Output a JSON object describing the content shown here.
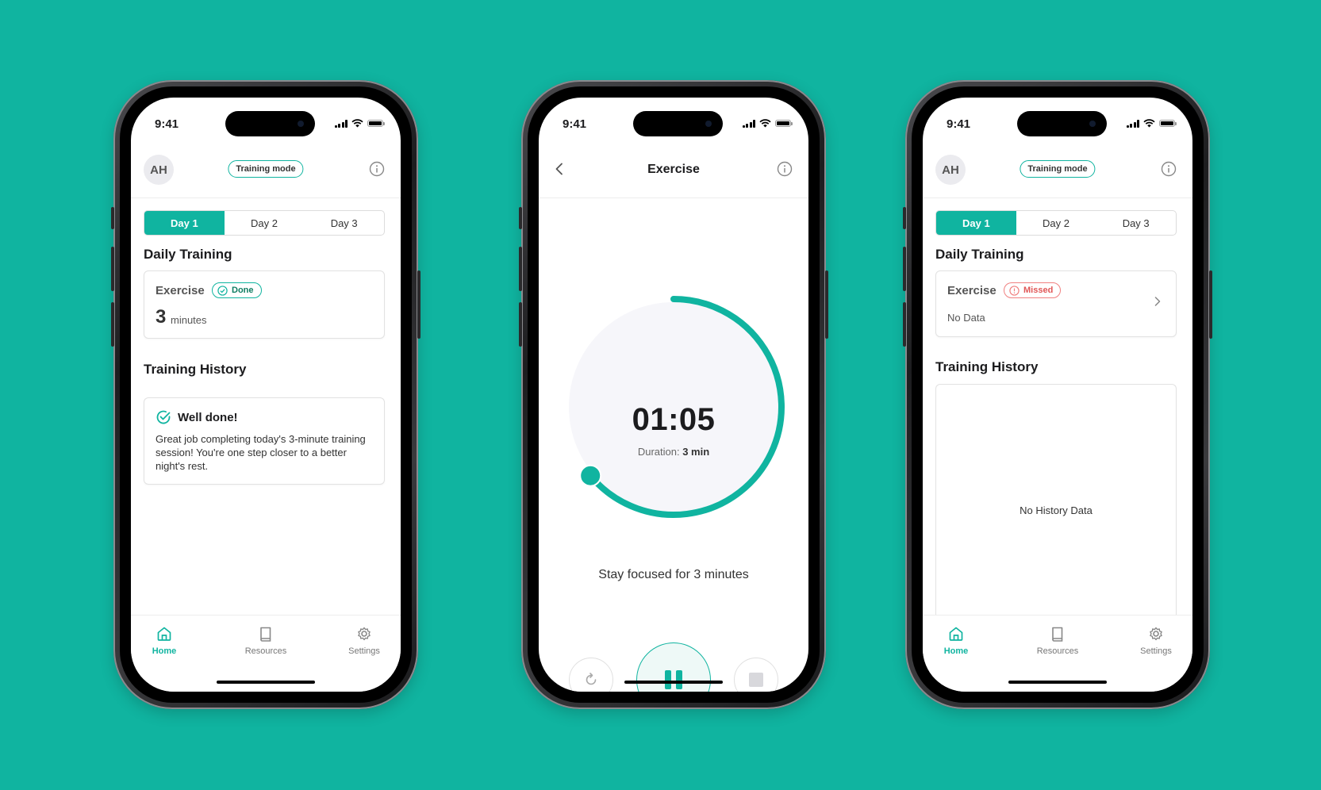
{
  "colors": {
    "background": "#10B4A0",
    "accent": "#10B4A0",
    "missed": "#e05757",
    "done": "#0f7d62"
  },
  "status_bar": {
    "time": "9:41"
  },
  "phone1": {
    "avatar": "AH",
    "mode_label": "Training mode",
    "tabs": [
      "Day 1",
      "Day 2",
      "Day 3"
    ],
    "daily_training_title": "Daily Training",
    "exercise_label": "Exercise",
    "status_badge": "Done",
    "minutes_value": "3",
    "minutes_unit": "minutes",
    "history_title": "Training History",
    "history_card_title": "Well done!",
    "history_card_text": "Great job completing today's 3-minute training session! You're one step closer to a better night's rest.",
    "nav": {
      "home": "Home",
      "resources": "Resources",
      "settings": "Settings"
    }
  },
  "phone2": {
    "title": "Exercise",
    "timer": "01:05",
    "duration_label": "Duration: ",
    "duration_value": "3 min",
    "focus_text": "Stay focused for 3 minutes",
    "progress_fraction": 0.64
  },
  "phone3": {
    "avatar": "AH",
    "mode_label": "Training mode",
    "tabs": [
      "Day 1",
      "Day 2",
      "Day 3"
    ],
    "daily_training_title": "Daily Training",
    "exercise_label": "Exercise",
    "status_badge": "Missed",
    "no_data": "No Data",
    "history_title": "Training History",
    "no_history": "No History Data",
    "nav": {
      "home": "Home",
      "resources": "Resources",
      "settings": "Settings"
    }
  }
}
